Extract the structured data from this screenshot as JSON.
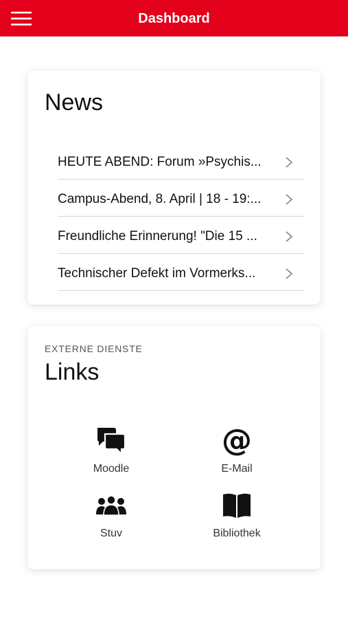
{
  "header": {
    "title": "Dashboard",
    "menu_icon": "hamburger-menu-icon",
    "background": "#e2001a"
  },
  "news": {
    "title": "News",
    "items": [
      {
        "label": "HEUTE ABEND: Forum »Psychis..."
      },
      {
        "label": "Campus-Abend, 8. April | 18 - 19:..."
      },
      {
        "label": "Freundliche Erinnerung! \"Die 15 ..."
      },
      {
        "label": "Technischer Defekt im Vormerks..."
      }
    ],
    "item_icon": "chevron-right-icon"
  },
  "links": {
    "overline": "EXTERNE DIENSTE",
    "title": "Links",
    "tiles": [
      {
        "label": "Moodle",
        "icon": "chat-bubbles-icon"
      },
      {
        "label": "E-Mail",
        "icon": "at-sign-icon"
      },
      {
        "label": "Stuv",
        "icon": "users-group-icon"
      },
      {
        "label": "Bibliothek",
        "icon": "open-book-icon"
      }
    ]
  }
}
